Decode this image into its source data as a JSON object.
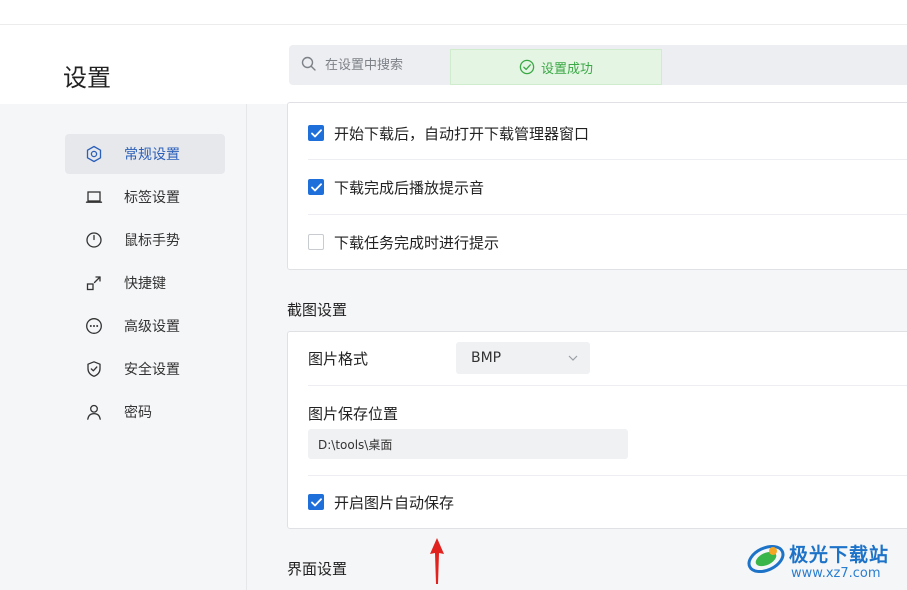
{
  "header": {
    "title": "设置"
  },
  "search": {
    "placeholder": "在设置中搜索",
    "icon": "search-icon"
  },
  "toast": {
    "text": "设置成功",
    "color": "#3aa845"
  },
  "sidebar": {
    "items": [
      {
        "label": "常规设置",
        "icon": "hexagon-settings-icon",
        "active": true
      },
      {
        "label": "标签设置",
        "icon": "laptop-tab-icon",
        "active": false
      },
      {
        "label": "鼠标手势",
        "icon": "mouse-icon",
        "active": false
      },
      {
        "label": "快捷键",
        "icon": "shortcut-arrow-icon",
        "active": false
      },
      {
        "label": "高级设置",
        "icon": "more-circle-icon",
        "active": false
      },
      {
        "label": "安全设置",
        "icon": "shield-icon",
        "active": false
      },
      {
        "label": "密码",
        "icon": "user-icon",
        "active": false
      }
    ]
  },
  "download": {
    "options": [
      {
        "label": "开始下载后，自动打开下载管理器窗口",
        "checked": true
      },
      {
        "label": "下载完成后播放提示音",
        "checked": true
      },
      {
        "label": "下载任务完成时进行提示",
        "checked": false
      }
    ]
  },
  "screenshot": {
    "title": "截图设置",
    "format_label": "图片格式",
    "format_value": "BMP",
    "save_location_label": "图片保存位置",
    "save_location_value": "D:\\tools\\桌面",
    "auto_save_label": "开启图片自动保存",
    "auto_save_checked": true
  },
  "interface": {
    "title": "界面设置"
  },
  "watermark": {
    "name": "极光下载站",
    "url": "www.xz7.com"
  },
  "colors": {
    "accent": "#1e6fd9",
    "active_nav_text": "#2b5fb9",
    "annotation_arrow": "#e0231f"
  }
}
